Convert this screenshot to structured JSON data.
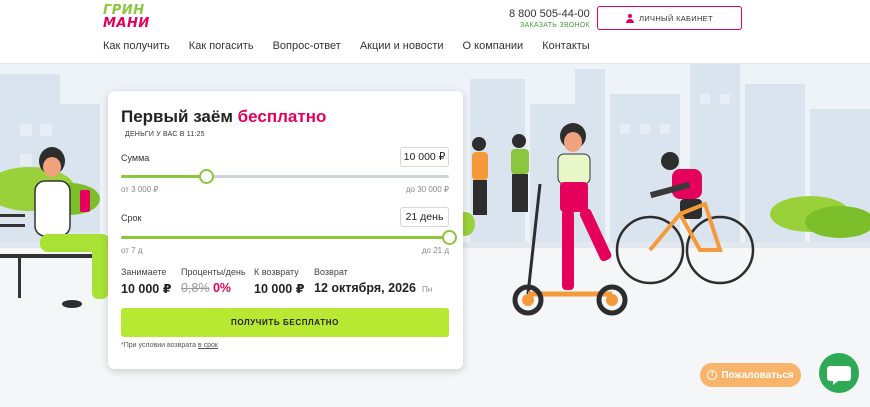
{
  "header": {
    "logo_line1": "ГРИН",
    "logo_line2": "МАНИ",
    "phone": "8 800 505-44-00",
    "callback_label": "ЗАКАЗАТЬ ЗВОНОК",
    "cabinet_label": "ЛИЧНЫЙ КАБИНЕТ",
    "nav": [
      "Как получить",
      "Как погасить",
      "Вопрос-ответ",
      "Акции и новости",
      "О компании",
      "Контакты"
    ]
  },
  "calculator": {
    "title": "Первый заём",
    "title_accent": "бесплатно",
    "subtitle": "ДЕНЬГИ У ВАС В 11:25",
    "amount": {
      "label": "Сумма",
      "value": "10 000 ₽",
      "min_label": "от 3 000 ₽",
      "max_label": "до 30 000 ₽",
      "fill_percent": 26
    },
    "term": {
      "label": "Срок",
      "value": "21 день",
      "min_label": "от 7 д",
      "max_label": "до 21 д",
      "fill_percent": 100
    },
    "summary": {
      "borrow_label": "Занимаете",
      "borrow_value": "10 000 ₽",
      "rate_label": "Проценты/день",
      "rate_old": "0,8%",
      "rate_new": "0%",
      "return_label": "К возврату",
      "return_value": "10 000 ₽",
      "date_label": "Возврат",
      "date_value": "12 октября, 2026",
      "date_day": "Пн"
    },
    "cta_label": "ПОЛУЧИТЬ БЕСПЛАТНО",
    "note_text": "*При условии возврата",
    "note_link": "в срок"
  },
  "complain_label": "Пожаловаться",
  "colors": {
    "brand_pink": "#e4005b",
    "brand_green": "#8cc63f",
    "cta_green": "#b8e831",
    "chat_green": "#2eaa57",
    "complain_orange": "#f8b46b"
  }
}
